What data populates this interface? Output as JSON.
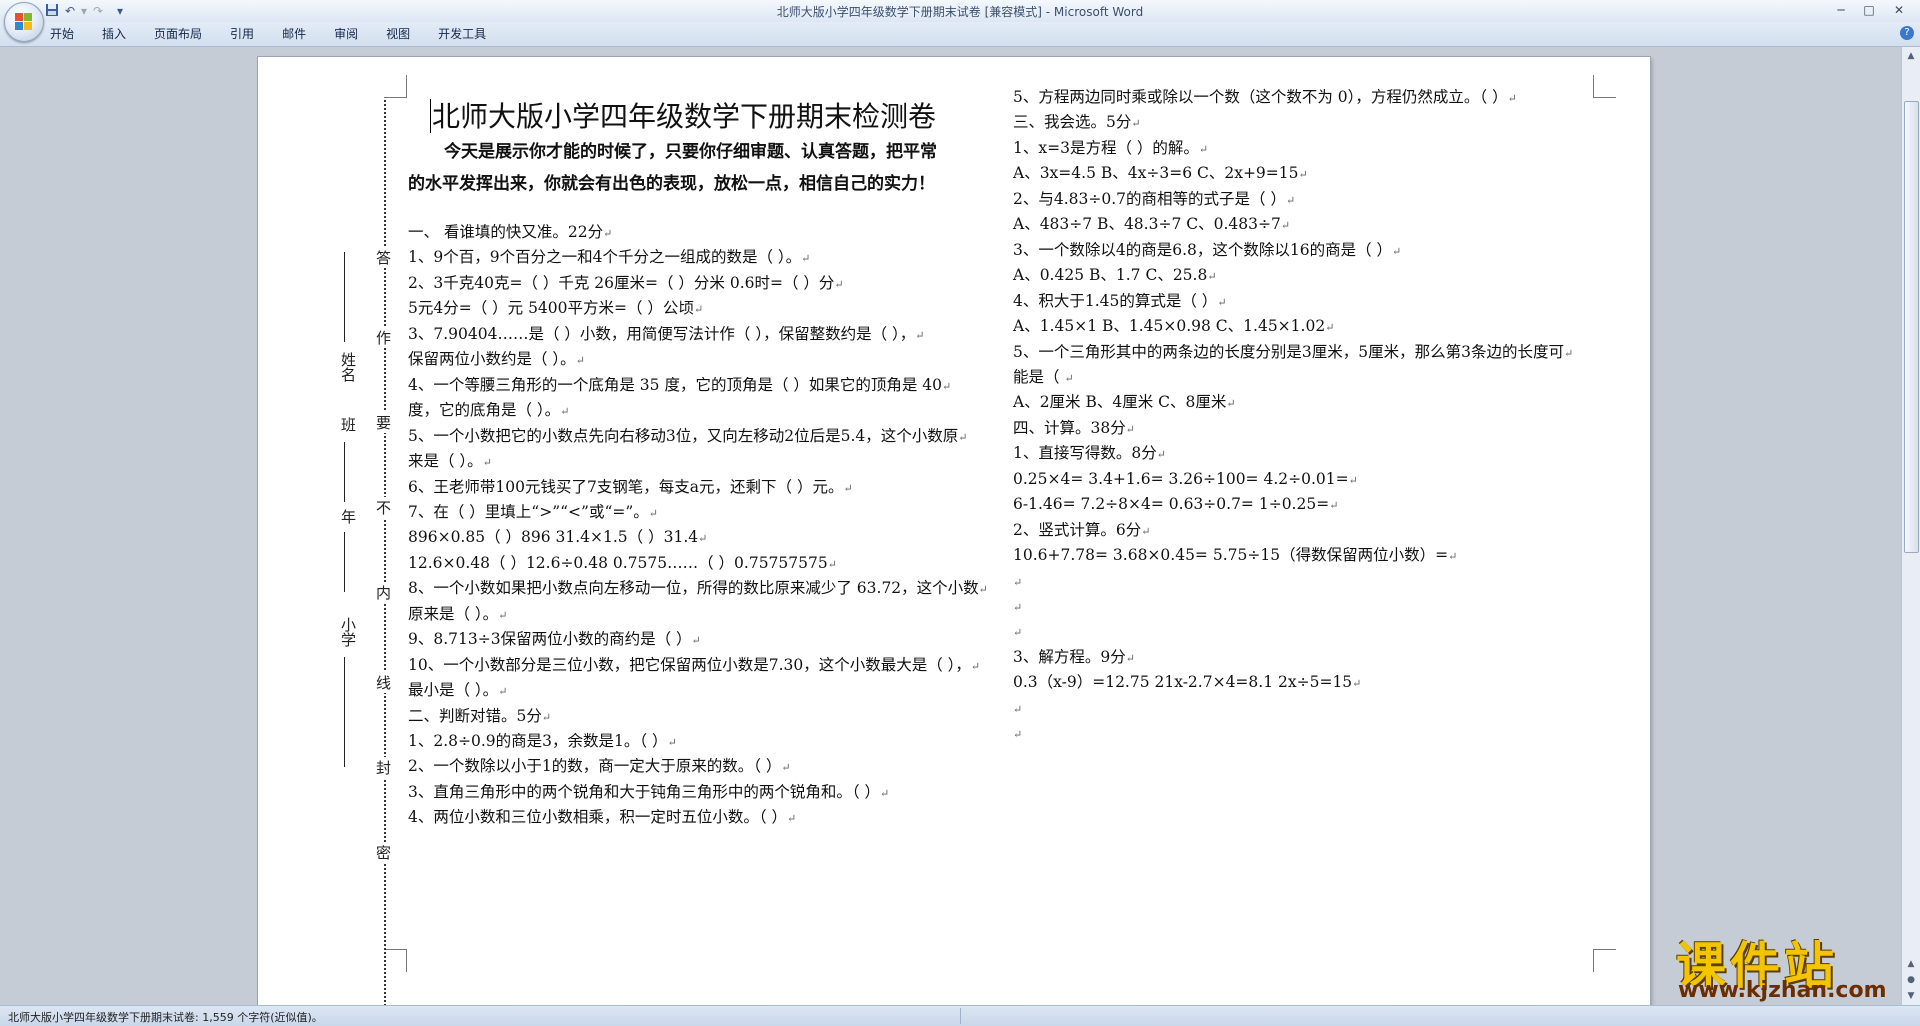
{
  "window": {
    "title": "北师大版小学四年级数学下册期末试卷 [兼容模式] - Microsoft Word",
    "controls": [
      "─",
      "□",
      "✕"
    ]
  },
  "quick_access": {
    "save_icon": "save-icon",
    "undo_icon": "undo-icon",
    "redo_icon": "redo-icon",
    "customize_icon": "dropdown-icon"
  },
  "ribbon": {
    "tabs": [
      "开始",
      "插入",
      "页面布局",
      "引用",
      "邮件",
      "审阅",
      "视图",
      "开发工具"
    ],
    "help": "?"
  },
  "binding": {
    "chars": [
      "答",
      "作",
      "要",
      "不",
      "内",
      "线",
      "封",
      "密"
    ],
    "labels": {
      "name": "姓名",
      "class": "班",
      "grade": "年",
      "school": "小学"
    }
  },
  "document": {
    "title": "北师大版小学四年级数学下册期末检测卷",
    "intro_1": "今天是展示你才能的时候了，只要你仔细审题、认真答题，把平常",
    "intro_2": "的水平发挥出来，你就会有出色的表现，放松一点，相信自己的实力！",
    "left": [
      "一、   看谁填的快又准。22分",
      "1、9个百，9个百分之一和4个千分之一组成的数是（          ）。",
      "2、3千克40克=（    ）千克      26厘米=（    ）分米        0.6时=（    ）分",
      "   5元4分=（      ）元          5400平方米=（      ）公顷",
      "3、7.90404……是（      ）小数，用简便写法计作（        ），保留整数约是（      ），",
      "保留两位小数约是（        ）。",
      "4、一个等腰三角形的一个底角是 35 度，它的顶角是（      ）如果它的顶角是 40",
      "度，它的底角是（      ）。",
      "5、一个小数把它的小数点先向右移动3位，又向左移动2位后是5.4，这个小数原",
      "来是（    ）。",
      "6、王老师带100元钱买了7支钢笔，每支a元，还剩下（      ）元。",
      "7、在（    ）里填上“>”“<”或“=”。",
      "896×0.85（  ）896                    31.4×1.5（    ）31.4",
      "12.6×0.48（  ）12.6÷0.48             0.7575……（    ）0.75757575",
      "8、一个小数如果把小数点向左移动一位，所得的数比原来减少了 63.72，这个小数",
      "原来是（    ）。",
      "9、8.713÷3保留两位小数的商约是（      ）",
      "10、一个小数部分是三位小数，把它保留两位小数是7.30，这个小数最大是（      ），",
      "最小是（      ）。",
      "二、判断对错。5分",
      "1、2.8÷0.9的商是3，余数是1。（      ）",
      "2、一个数除以小于1的数，商一定大于原来的数。（      ）",
      "3、直角三角形中的两个锐角和大于钝角三角形中的两个锐角和。（      ）",
      "4、两位小数和三位小数相乘，积一定时五位小数。（      ）"
    ],
    "right": [
      "5、方程两边同时乘或除以一个数（这个数不为 0），方程仍然成立。（     ）",
      "三、我会选。5分",
      "1、x=3是方程（    ）的解。",
      "A、3x=4.5      B、4x÷3=6        C、2x+9=15",
      "2、与4.83÷0.7的商相等的式子是（      ）",
      "A、483÷7      B、48.3÷7      C、0.483÷7",
      "3、一个数除以4的商是6.8，这个数除以16的商是（      ）",
      "A、0.425        B、1.7            C、25.8",
      "4、积大于1.45的算式是（      ）",
      "A、1.45×1      B、1.45×0.98      C、1.45×1.02",
      "5、一个三角形其中的两条边的长度分别是3厘米，5厘米，那么第3条边的长度可",
      "能是（    ",
      "A、2厘米        B、4厘米        C、8厘米",
      "四、计算。38分",
      "1、直接写得数。8分",
      "0.25×4=          3.4+1.6=          3.26÷100=        4.2÷0.01=",
      "6-1.46=          7.2÷8×4=          0.63÷0.7=        1÷0.25=",
      "2、竖式计算。6分",
      "10.6+7.78=              3.68×0.45=            5.75÷15（得数保留两位小数）=",
      "",
      "",
      "",
      "3、解方程。9分",
      "0.3（x-9）=12.75              21x-2.7×4=8.1          2x÷5=15",
      "",
      ""
    ]
  },
  "status": {
    "text": "北师大版小学四年级数学下册期末试卷: 1,559 个字符(近似值)。"
  },
  "watermark": {
    "cn": "课件站",
    "url": "www.kjzhan.com"
  },
  "colors": {
    "accent": "#3a78d0",
    "watermark": "#f4c400"
  }
}
